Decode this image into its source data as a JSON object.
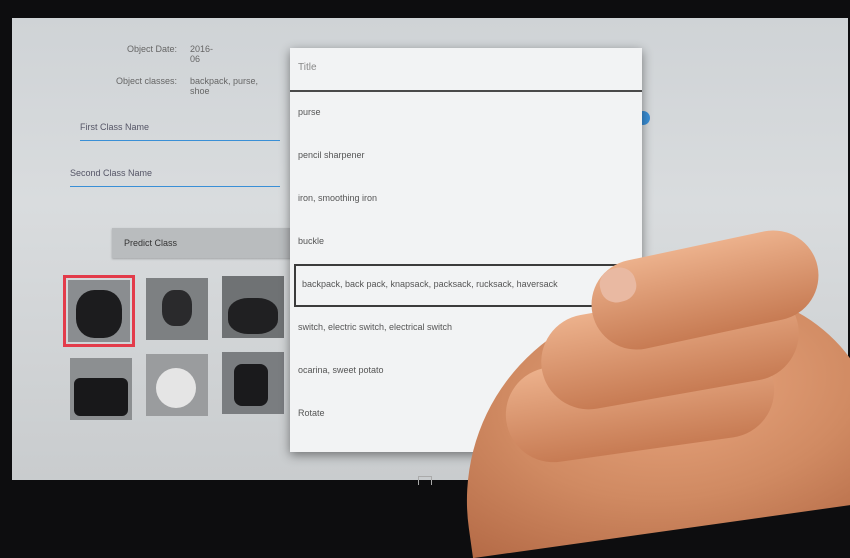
{
  "info": {
    "row1_label": "Object Date:",
    "row1_value": "2016-06",
    "row2_label": "Object classes:",
    "row2_value": "backpack, purse, shoe"
  },
  "fields": {
    "first_label": "First Class Name",
    "second_label": "Second Class Name"
  },
  "action_button": {
    "label": "Predict Class"
  },
  "dropdown": {
    "header": "Title",
    "items": [
      "purse",
      "pencil sharpener",
      "iron, smoothing iron",
      "buckle",
      "backpack, back pack, knapsack, packsack, rucksack, haversack",
      "switch, electric switch, electrical switch",
      "ocarina, sweet potato",
      "Rotate"
    ],
    "highlighted_index": 4
  },
  "colors": {
    "accent": "#3a8fd6",
    "selection": "#e33b4a"
  }
}
